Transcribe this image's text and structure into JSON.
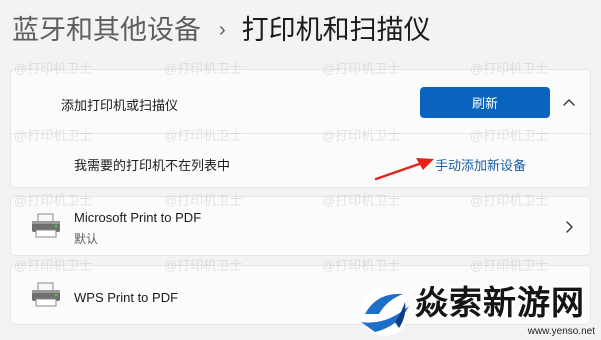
{
  "breadcrumb": {
    "parent": "蓝牙和其他设备",
    "separator": "›",
    "current": "打印机和扫描仪"
  },
  "add_section": {
    "title": "添加打印机或扫描仪",
    "refresh_label": "刷新",
    "missing_printer_text": "我需要的打印机不在列表中",
    "manual_add_link": "手动添加新设备"
  },
  "printers": [
    {
      "name": "Microsoft Print to PDF",
      "status": "默认",
      "icon": "printer-icon"
    },
    {
      "name": "WPS Print to PDF",
      "status": "",
      "icon": "printer-icon"
    }
  ],
  "watermark": {
    "text": "@打印机卫士"
  },
  "site_logo": {
    "text": "焱索新游网",
    "url": "www.yenso.net"
  },
  "colors": {
    "accent": "#0a63be",
    "link": "#1b5ea8",
    "arrow": "#e8201b",
    "background": "#f3f3f3"
  }
}
